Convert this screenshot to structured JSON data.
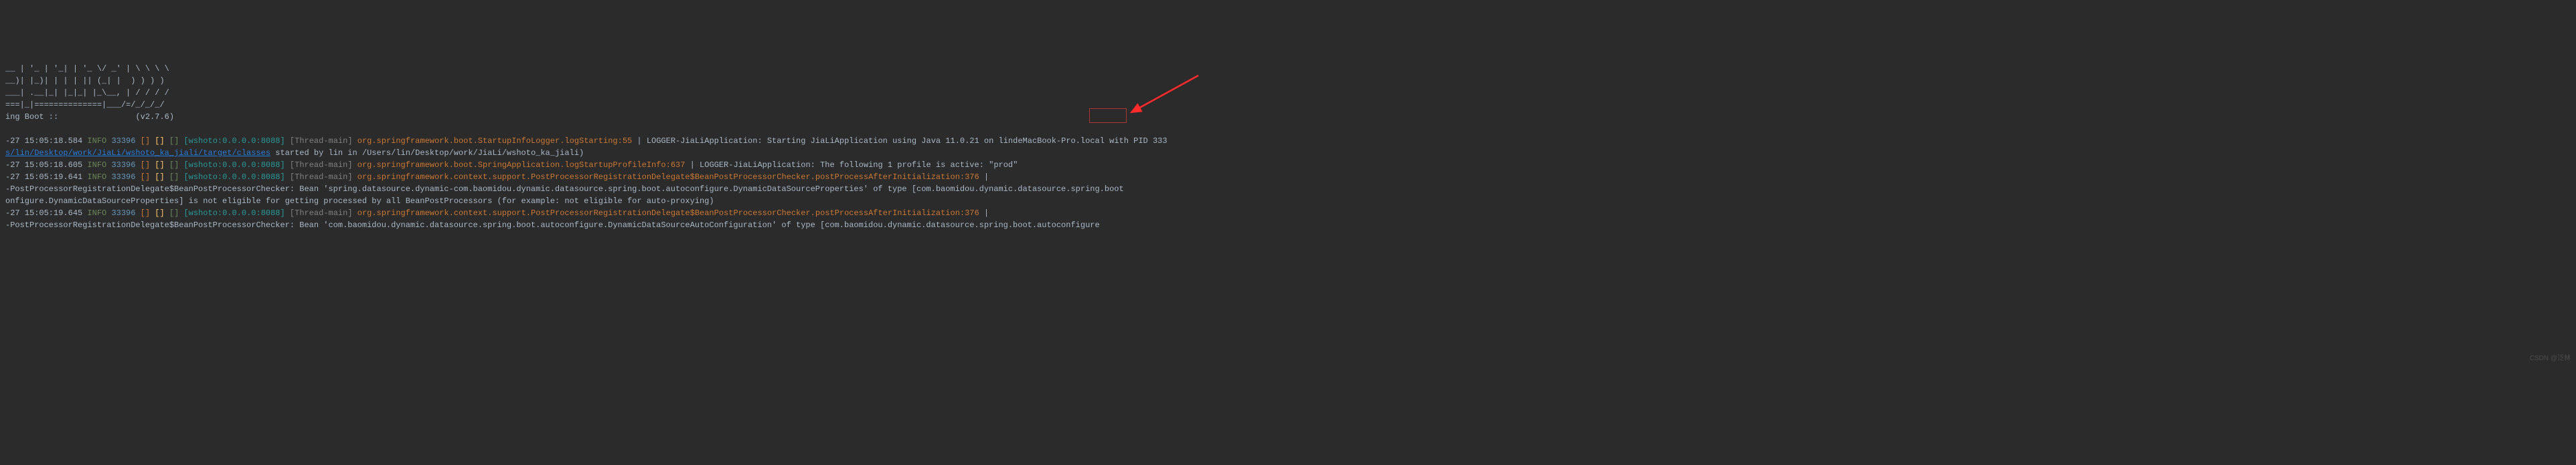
{
  "ascii": {
    "l1": "__ | '_ | '_| | '_ \\/ _' | \\ \\ \\ \\",
    "l2": "__)| |_)| | | | || (_| |  ) ) ) )",
    "l3": "___| .__|_| |_|_| |_\\__, | / / / /",
    "l4": "===|_|==============|___/=/_/_/_/",
    "l5_left": "ing Boot ::",
    "l5_right": "                (v2.7.6)"
  },
  "lines": [
    {
      "ts": "-27 15:05:18.584",
      "level": "INFO",
      "pid": "33396",
      "ctx": "[wshoto:0.0.0.0:8088]",
      "thread": "[Thread-main]",
      "logger": "org.springframework.boot.StartupInfoLogger.logStarting:55",
      "msg": " | LOGGER-JiaLiApplication: Starting JiaLiApplication using Java 11.0.21 on lindeMacBook-Pro.local with PID 333"
    },
    {
      "continuation": true,
      "path": "s/lin/Desktop/work/JiaLi/wshoto_ka_jiali/target/classes",
      "tail": " started by lin in /Users/lin/Desktop/work/JiaLi/wshoto_ka_jiali)"
    },
    {
      "ts": "-27 15:05:18.605",
      "level": "INFO",
      "pid": "33396",
      "ctx": "[wshoto:0.0.0.0:8088]",
      "thread": "[Thread-main]",
      "logger": "org.springframework.boot.SpringApplication.logStartupProfileInfo:637",
      "msg": " | LOGGER-JiaLiApplication: The following 1 profile is active: \"prod\""
    },
    {
      "ts": "-27 15:05:19.641",
      "level": "INFO",
      "pid": "33396",
      "ctx": "[wshoto:0.0.0.0:8088]",
      "thread": "[Thread-main]",
      "logger": "org.springframework.context.support.PostProcessorRegistrationDelegate$BeanPostProcessorChecker.postProcessAfterInitialization:376",
      "msg": " | "
    },
    {
      "continuation": true,
      "plain": "-PostProcessorRegistrationDelegate$BeanPostProcessorChecker: Bean 'spring.datasource.dynamic-com.baomidou.dynamic.datasource.spring.boot.autoconfigure.DynamicDataSourceProperties' of type [com.baomidou.dynamic.datasource.spring.boot"
    },
    {
      "continuation": true,
      "plain": "onfigure.DynamicDataSourceProperties] is not eligible for getting processed by all BeanPostProcessors (for example: not eligible for auto-proxying)"
    },
    {
      "ts": "-27 15:05:19.645",
      "level": "INFO",
      "pid": "33396",
      "ctx": "[wshoto:0.0.0.0:8088]",
      "thread": "[Thread-main]",
      "logger": "org.springframework.context.support.PostProcessorRegistrationDelegate$BeanPostProcessorChecker.postProcessAfterInitialization:376",
      "msg": " | "
    },
    {
      "continuation": true,
      "plain": "-PostProcessorRegistrationDelegate$BeanPostProcessorChecker: Bean 'com.baomidou.dynamic.datasource.spring.boot.autoconfigure.DynamicDataSourceAutoConfiguration' of type [com.baomidou.dynamic.datasource.spring.boot.autoconfigure"
    }
  ],
  "brackets": {
    "b1": "[]",
    "b2": "[]",
    "b3": "[]"
  },
  "watermark": "CSDN @泛林"
}
